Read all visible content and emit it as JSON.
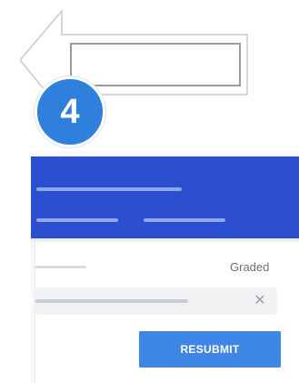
{
  "callout": {
    "step_number": "4"
  },
  "assignment": {
    "status": "Graded",
    "resubmit_label": "RESUBMIT",
    "remove_symbol": "✕"
  },
  "colors": {
    "header": "#2c4fd0",
    "badge": "#2f7fdc",
    "button": "#3d86e6"
  },
  "icons": [
    "left-arrow-icon",
    "close-icon"
  ]
}
